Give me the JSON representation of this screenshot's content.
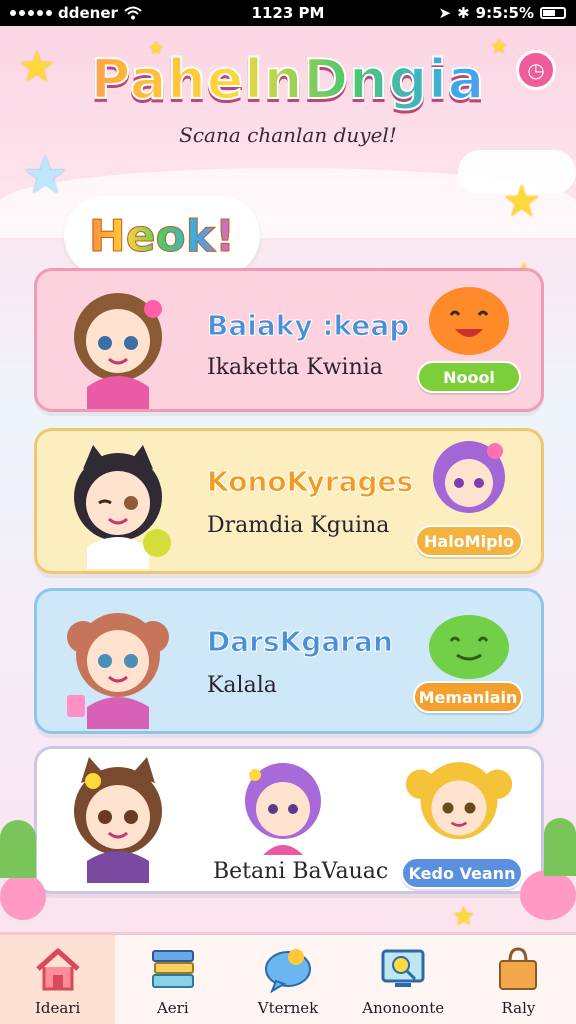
{
  "status_bar": {
    "carrier": "ddener",
    "time": "1123 PM",
    "battery": "9:5:5%"
  },
  "header": {
    "app_title": "PahelnDngia",
    "subtitle": "Scana chanlan duyel!",
    "greeting": "Heok!"
  },
  "cards": [
    {
      "name": "Baiaky :keap",
      "subtitle": "Ikaketta Kwinia",
      "button": "Noool",
      "bg": "#fbd2dd",
      "border": "#f29ab5",
      "name_color": "#4a90d9",
      "button_color": "#7dcf3a"
    },
    {
      "name": "KonoKyrages",
      "subtitle": "Dramdia Kguina",
      "button": "HaloMiplo",
      "bg": "#fdeec0",
      "border": "#f1c670",
      "name_color": "#f29a22",
      "button_color": "#f4b23e"
    },
    {
      "name": "DarsKgaran",
      "subtitle": "Kalala",
      "button": "Memanlain",
      "bg": "#cfe8f8",
      "border": "#8cc6ea",
      "name_color": "#4a90d9",
      "button_color": "#f4a02e"
    },
    {
      "name": "",
      "subtitle": "Betani BaVauac",
      "button": "Kedo Veann",
      "bg": "#ffffff",
      "border": "#c9c6e6",
      "name_color": "#4a90d9",
      "button_color": "#5b8fe0"
    }
  ],
  "tabs": [
    {
      "label": "Ideari",
      "icon": "home-icon"
    },
    {
      "label": "Aeri",
      "icon": "books-icon"
    },
    {
      "label": "Vternek",
      "icon": "chat-bubble-icon"
    },
    {
      "label": "Anonoonte",
      "icon": "search-screen-icon"
    },
    {
      "label": "Raly",
      "icon": "shopping-bag-icon"
    }
  ]
}
